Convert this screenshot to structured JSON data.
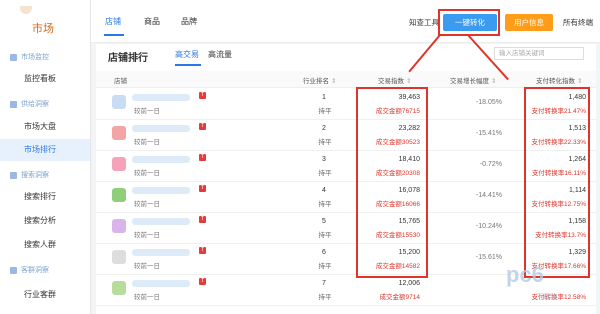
{
  "sidebar": {
    "title": "市场",
    "sections": [
      {
        "label": "市场监控",
        "items": [
          "监控看板"
        ]
      },
      {
        "label": "供给洞察",
        "items": [
          "市场大盘",
          "市场排行"
        ]
      },
      {
        "label": "搜索洞察",
        "items": [
          "搜索排行",
          "搜索分析",
          "搜索人群"
        ]
      },
      {
        "label": "客群洞察",
        "items": [
          "行业客群"
        ]
      }
    ],
    "active_item": "市场排行"
  },
  "topbar": {
    "tabs": [
      "店铺",
      "商品",
      "品牌"
    ],
    "active_tab": "店铺",
    "tool_label": "知查工具",
    "convert_button": "一键转化",
    "user_button": "用户信息",
    "terminal_label": "所有终端"
  },
  "panel": {
    "title": "店铺排行",
    "subtabs": [
      "高交易",
      "高流量"
    ],
    "active_subtab": "高交易",
    "search_placeholder": "输入店铺关键词",
    "columns": [
      "店铺",
      "行业排名",
      "交易指数",
      "交易增长幅度",
      "支付转化指数"
    ],
    "compare_label": "较前一日"
  },
  "rows": [
    {
      "rank": "1",
      "rank_change": "持平",
      "trade_index": "39,463",
      "trade_amount": "成交金额76715",
      "growth": "-18.05%",
      "pay_index": "1,480",
      "pay_rate": "支付转换率21.47%",
      "thumb_color": "#c8dcf2"
    },
    {
      "rank": "2",
      "rank_change": "持平",
      "trade_index": "23,282",
      "trade_amount": "成交金额30523",
      "growth": "-15.41%",
      "pay_index": "1,513",
      "pay_rate": "支付转换率22.33%",
      "thumb_color": "#f3a5a5"
    },
    {
      "rank": "3",
      "rank_change": "持平",
      "trade_index": "18,410",
      "trade_amount": "成交金额20308",
      "growth": "-0.72%",
      "pay_index": "1,264",
      "pay_rate": "支付转换率16.11%",
      "thumb_color": "#f5a3b8"
    },
    {
      "rank": "4",
      "rank_change": "持平",
      "trade_index": "16,078",
      "trade_amount": "成交金额16066",
      "growth": "-14.41%",
      "pay_index": "1,114",
      "pay_rate": "支付转换率12.75%",
      "thumb_color": "#8fcf7a"
    },
    {
      "rank": "5",
      "rank_change": "持平",
      "trade_index": "15,765",
      "trade_amount": "成交金额15530",
      "growth": "-10.24%",
      "pay_index": "1,158",
      "pay_rate": "支付转换率13.7%",
      "thumb_color": "#d9b4e8"
    },
    {
      "rank": "6",
      "rank_change": "持平",
      "trade_index": "15,200",
      "trade_amount": "成交金额14582",
      "growth": "-15.61%",
      "pay_index": "1,329",
      "pay_rate": "支付转换率17.66%",
      "thumb_color": "#dddddd"
    },
    {
      "rank": "7",
      "rank_change": "持平",
      "trade_index": "12,006",
      "trade_amount": "成交金额9714",
      "growth": "",
      "pay_index": "",
      "pay_rate": "支付转换率12.58%",
      "thumb_color": "#b7dc9c"
    }
  ],
  "watermark": {
    "logo": "pc6",
    "sub": "下载站"
  },
  "colors": {
    "accent": "#2b78e4",
    "highlight": "#e0342a",
    "orange": "#ff9d1a"
  }
}
